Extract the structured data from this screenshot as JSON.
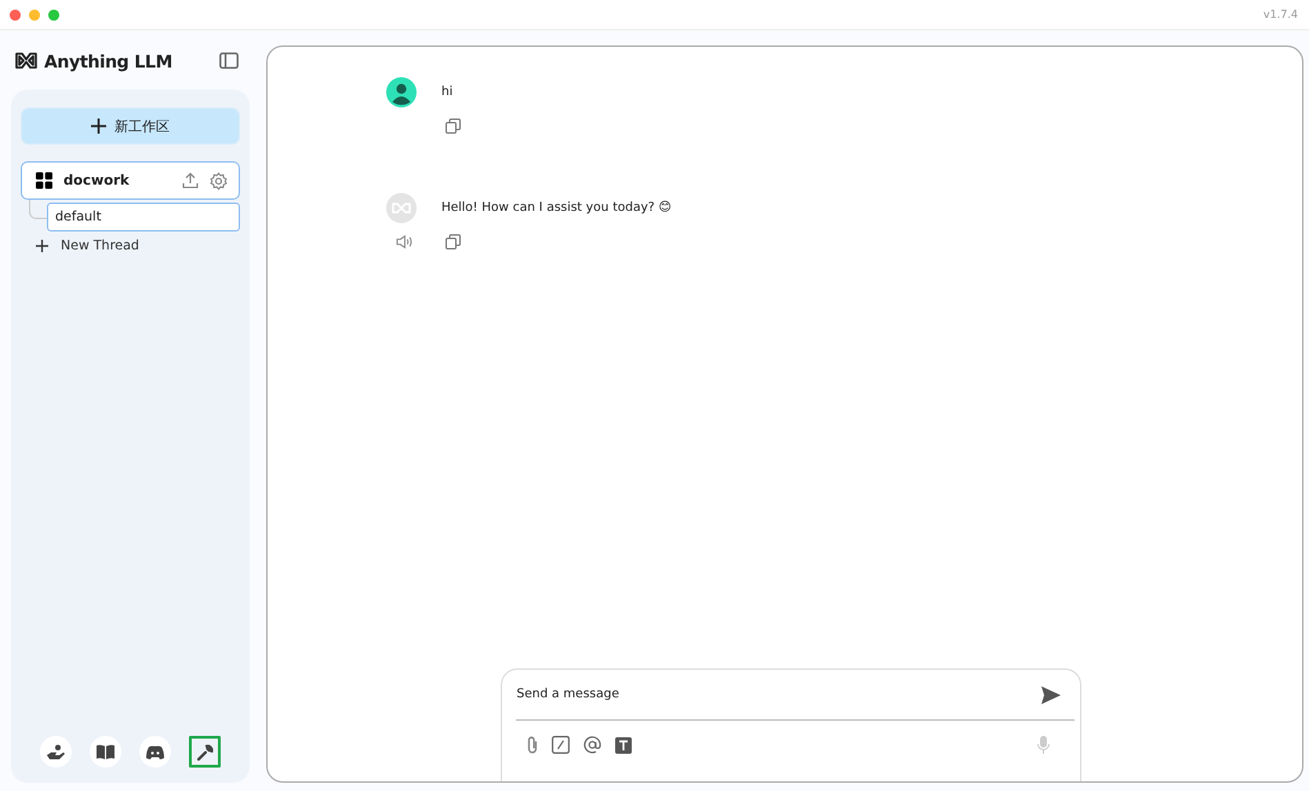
{
  "title_bar": {
    "version": "v1.7.4"
  },
  "sidebar": {
    "logo": "Anything LLM",
    "new_workspace": "新工作区",
    "workspaces": [
      {
        "name": "docwork",
        "selected": true,
        "threads": [
          {
            "name": "default",
            "selected": true
          }
        ]
      }
    ],
    "new_thread": "New Thread",
    "footer_buttons": [
      {
        "kind": "community",
        "selected": false
      },
      {
        "kind": "docs",
        "selected": false
      },
      {
        "kind": "discord",
        "selected": false
      },
      {
        "kind": "settings",
        "selected": true
      }
    ]
  },
  "messages": [
    {
      "kind": "user",
      "text": "hi"
    },
    {
      "kind": "assistant",
      "text": "Hello! How can I assist you today? 😊"
    }
  ],
  "composer": {
    "placeholder": "Send a message"
  }
}
